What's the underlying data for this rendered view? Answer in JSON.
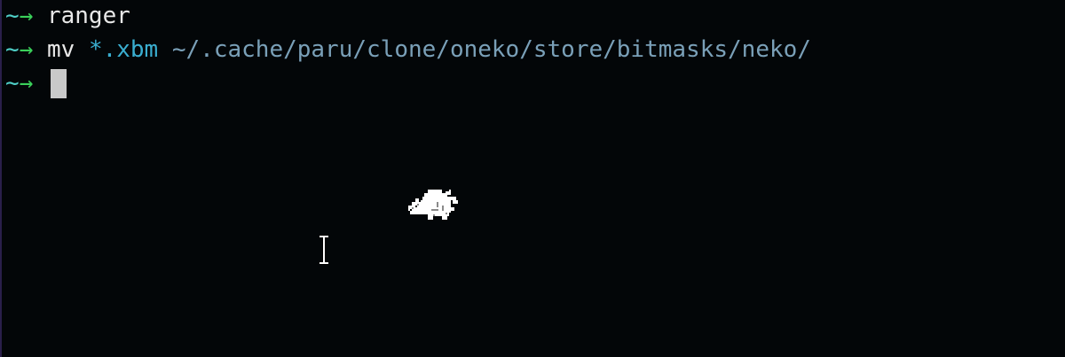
{
  "terminal": {
    "prompt": {
      "tilde": "~",
      "arrow": "→"
    },
    "lines": [
      {
        "command": "ranger"
      },
      {
        "command": "mv",
        "glob": "*.xbm",
        "path": "~/.cache/paru/clone/oneko/store/bitmasks/neko/"
      },
      {
        "command": ""
      }
    ]
  },
  "icons": {
    "cursor": "block-cursor",
    "neko": "neko-cat-sprite",
    "mouse": "i-beam-cursor-icon"
  },
  "colors": {
    "background": "#030608",
    "prompt_tilde": "#4fd0c8",
    "prompt_arrow": "#3ad05a",
    "command": "#e8e8e8",
    "glob": "#3aaed0",
    "path": "#7aa0b8"
  }
}
